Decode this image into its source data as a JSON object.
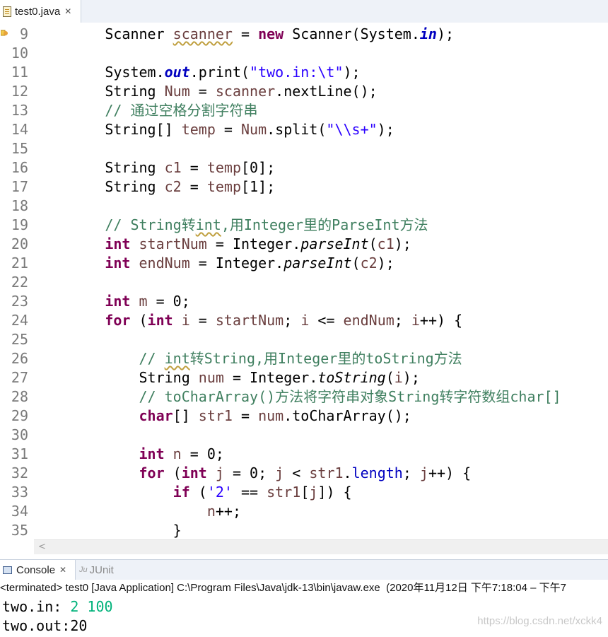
{
  "editor_tab": {
    "title": "test0.java",
    "close": "✕"
  },
  "lines": [
    {
      "n": "9",
      "c": [
        [
          "",
          "        Scanner "
        ],
        [
          "var sq",
          "scanner"
        ],
        [
          "",
          " = "
        ],
        [
          "kw",
          "new"
        ],
        [
          "",
          " Scanner(System."
        ],
        [
          "fld",
          "in"
        ],
        [
          "",
          ");"
        ]
      ]
    },
    {
      "n": "10",
      "c": []
    },
    {
      "n": "11",
      "c": [
        [
          "",
          "        System."
        ],
        [
          "fld",
          "out"
        ],
        [
          "",
          ".print("
        ],
        [
          "str",
          "\"two.in:\\t\""
        ],
        [
          "",
          ");"
        ]
      ]
    },
    {
      "n": "12",
      "c": [
        [
          "",
          "        String "
        ],
        [
          "var",
          "Num"
        ],
        [
          "",
          " = "
        ],
        [
          "var",
          "scanner"
        ],
        [
          "",
          ".nextLine();"
        ]
      ]
    },
    {
      "n": "13",
      "c": [
        [
          "cm",
          "        // 通过空格分割字符串"
        ]
      ]
    },
    {
      "n": "14",
      "c": [
        [
          "",
          "        String[] "
        ],
        [
          "var",
          "temp"
        ],
        [
          "",
          " = "
        ],
        [
          "var",
          "Num"
        ],
        [
          "",
          ".split("
        ],
        [
          "str",
          "\"\\\\s+\""
        ],
        [
          "",
          ");"
        ]
      ]
    },
    {
      "n": "15",
      "c": []
    },
    {
      "n": "16",
      "c": [
        [
          "",
          "        String "
        ],
        [
          "var",
          "c1"
        ],
        [
          "",
          " = "
        ],
        [
          "var",
          "temp"
        ],
        [
          "",
          "[0];"
        ]
      ]
    },
    {
      "n": "17",
      "c": [
        [
          "",
          "        String "
        ],
        [
          "var",
          "c2"
        ],
        [
          "",
          " = "
        ],
        [
          "var",
          "temp"
        ],
        [
          "",
          "[1];"
        ]
      ]
    },
    {
      "n": "18",
      "c": []
    },
    {
      "n": "19",
      "c": [
        [
          "cm",
          "        // String转"
        ],
        [
          "cm sq",
          "int"
        ],
        [
          "cm",
          ",用Integer里的ParseInt方法"
        ]
      ]
    },
    {
      "n": "20",
      "c": [
        [
          "",
          "        "
        ],
        [
          "kw",
          "int"
        ],
        [
          "",
          " "
        ],
        [
          "var",
          "startNum"
        ],
        [
          "",
          " = Integer."
        ],
        [
          "ital",
          "parseInt"
        ],
        [
          "",
          "("
        ],
        [
          "var",
          "c1"
        ],
        [
          "",
          ");"
        ]
      ]
    },
    {
      "n": "21",
      "c": [
        [
          "",
          "        "
        ],
        [
          "kw",
          "int"
        ],
        [
          "",
          " "
        ],
        [
          "var",
          "endNum"
        ],
        [
          "",
          " = Integer."
        ],
        [
          "ital",
          "parseInt"
        ],
        [
          "",
          "("
        ],
        [
          "var",
          "c2"
        ],
        [
          "",
          ");"
        ]
      ]
    },
    {
      "n": "22",
      "c": []
    },
    {
      "n": "23",
      "c": [
        [
          "",
          "        "
        ],
        [
          "kw",
          "int"
        ],
        [
          "",
          " "
        ],
        [
          "var",
          "m"
        ],
        [
          "",
          " = 0;"
        ]
      ]
    },
    {
      "n": "24",
      "c": [
        [
          "",
          "        "
        ],
        [
          "kw",
          "for"
        ],
        [
          "",
          " ("
        ],
        [
          "kw",
          "int"
        ],
        [
          "",
          " "
        ],
        [
          "var",
          "i"
        ],
        [
          "",
          " = "
        ],
        [
          "var",
          "startNum"
        ],
        [
          "",
          "; "
        ],
        [
          "var",
          "i"
        ],
        [
          "",
          " <= "
        ],
        [
          "var",
          "endNum"
        ],
        [
          "",
          "; "
        ],
        [
          "var",
          "i"
        ],
        [
          "",
          "++) {"
        ]
      ]
    },
    {
      "n": "25",
      "c": []
    },
    {
      "n": "26",
      "c": [
        [
          "cm",
          "            // "
        ],
        [
          "cm sq",
          "int"
        ],
        [
          "cm",
          "转String,用Integer里的toString方法"
        ]
      ]
    },
    {
      "n": "27",
      "c": [
        [
          "",
          "            String "
        ],
        [
          "var",
          "num"
        ],
        [
          "",
          " = Integer."
        ],
        [
          "ital",
          "toString"
        ],
        [
          "",
          "("
        ],
        [
          "var",
          "i"
        ],
        [
          "",
          ");"
        ]
      ]
    },
    {
      "n": "28",
      "c": [
        [
          "cm",
          "            // toCharArray()方法将字符串对象String转字符数组char[]"
        ]
      ]
    },
    {
      "n": "29",
      "c": [
        [
          "",
          "            "
        ],
        [
          "kw",
          "char"
        ],
        [
          "",
          "[] "
        ],
        [
          "var",
          "str1"
        ],
        [
          "",
          " = "
        ],
        [
          "var",
          "num"
        ],
        [
          "",
          ".toCharArray();"
        ]
      ]
    },
    {
      "n": "30",
      "c": []
    },
    {
      "n": "31",
      "c": [
        [
          "",
          "            "
        ],
        [
          "kw",
          "int"
        ],
        [
          "",
          " "
        ],
        [
          "var",
          "n"
        ],
        [
          "",
          " = 0;"
        ]
      ]
    },
    {
      "n": "32",
      "c": [
        [
          "",
          "            "
        ],
        [
          "kw",
          "for"
        ],
        [
          "",
          " ("
        ],
        [
          "kw",
          "int"
        ],
        [
          "",
          " "
        ],
        [
          "var",
          "j"
        ],
        [
          "",
          " = 0; "
        ],
        [
          "var",
          "j"
        ],
        [
          "",
          " < "
        ],
        [
          "var",
          "str1"
        ],
        [
          "",
          "."
        ],
        [
          "plainfld",
          "length"
        ],
        [
          "",
          "; "
        ],
        [
          "var",
          "j"
        ],
        [
          "",
          "++) {"
        ]
      ]
    },
    {
      "n": "33",
      "c": [
        [
          "",
          "                "
        ],
        [
          "kw",
          "if"
        ],
        [
          "",
          " ("
        ],
        [
          "str",
          "'2'"
        ],
        [
          "",
          " == "
        ],
        [
          "var",
          "str1"
        ],
        [
          "",
          "["
        ],
        [
          "var",
          "j"
        ],
        [
          "",
          "]) {"
        ]
      ]
    },
    {
      "n": "34",
      "c": [
        [
          "",
          "                    "
        ],
        [
          "var",
          "n"
        ],
        [
          "",
          "++;"
        ]
      ]
    },
    {
      "n": "35",
      "c": [
        [
          "",
          "                }"
        ]
      ]
    }
  ],
  "console": {
    "tab_console": "Console",
    "tab_console_close": "✕",
    "tab_junit_icon": "Ju",
    "tab_junit": "JUnit",
    "status": "<terminated> test0 [Java Application] C:\\Program Files\\Java\\jdk-13\\bin\\javaw.exe  (2020年11月12日 下午7:18:04 – 下午7",
    "out1_prompt": "two.in: ",
    "out1_input": "2 100",
    "out2": "two.out:20"
  },
  "watermark": "https://blog.csdn.net/xckk4",
  "scroll_arrow": "<"
}
